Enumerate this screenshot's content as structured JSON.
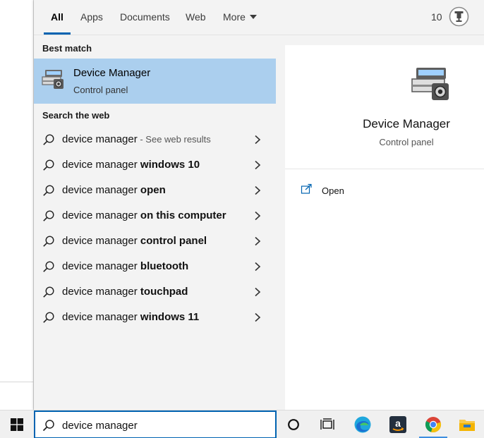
{
  "tabs": [
    {
      "label": "All",
      "active": true
    },
    {
      "label": "Apps",
      "active": false
    },
    {
      "label": "Documents",
      "active": false
    },
    {
      "label": "Web",
      "active": false
    },
    {
      "label": "More",
      "active": false
    }
  ],
  "rewards": {
    "points": "10",
    "icon": "trophy-icon"
  },
  "best_match": {
    "section_label": "Best match",
    "title": "Device Manager",
    "subtitle": "Control panel",
    "icon": "device-manager-icon"
  },
  "web": {
    "section_label": "Search the web",
    "items": [
      {
        "base": "device manager",
        "bold": "",
        "hint": " - See web results"
      },
      {
        "base": "device manager ",
        "bold": "windows 10",
        "hint": ""
      },
      {
        "base": "device manager ",
        "bold": "open",
        "hint": ""
      },
      {
        "base": "device manager ",
        "bold": "on this computer",
        "hint": ""
      },
      {
        "base": "device manager ",
        "bold": "control panel",
        "hint": ""
      },
      {
        "base": "device manager ",
        "bold": "bluetooth",
        "hint": ""
      },
      {
        "base": "device manager ",
        "bold": "touchpad",
        "hint": ""
      },
      {
        "base": "device manager ",
        "bold": "windows 11",
        "hint": ""
      }
    ]
  },
  "preview": {
    "title": "Device Manager",
    "subtitle": "Control panel",
    "actions": [
      {
        "label": "Open",
        "icon": "open-window-icon"
      }
    ]
  },
  "taskbar": {
    "search_value": "device manager",
    "icons": [
      "windows-start-icon",
      "cortana-icon",
      "task-view-icon",
      "edge-icon",
      "amazon-icon",
      "chrome-icon",
      "file-explorer-icon"
    ]
  },
  "colors": {
    "accent": "#0063b1",
    "selection": "#abcfee",
    "panel_bg": "#f3f3f3"
  }
}
